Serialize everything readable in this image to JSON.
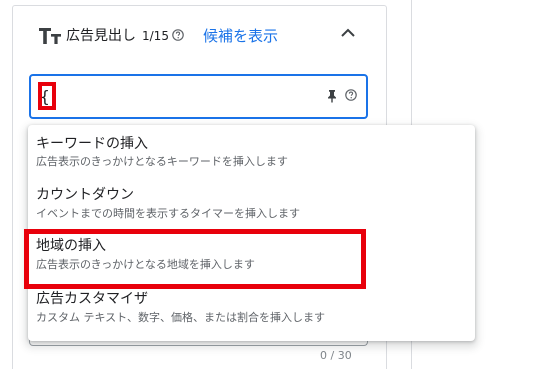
{
  "header": {
    "title": "広告見出し",
    "count": "1/15",
    "suggest_link": "候補を表示"
  },
  "input": {
    "value": "{",
    "counter": "0 / 30"
  },
  "dropdown": {
    "items": [
      {
        "title": "キーワードの挿入",
        "desc": "広告表示のきっかけとなるキーワードを挿入します"
      },
      {
        "title": "カウントダウン",
        "desc": "イベントまでの時間を表示するタイマーを挿入します"
      },
      {
        "title": "地域の挿入",
        "desc": "広告表示のきっかけとなる地域を挿入します"
      },
      {
        "title": "広告カスタマイザ",
        "desc": "カスタム テキスト、数字、価格、または割合を挿入します"
      }
    ]
  },
  "colors": {
    "accent": "#1a73e8",
    "highlight": "#e8000b",
    "text": "#202124",
    "secondary_text": "#5f6368"
  }
}
